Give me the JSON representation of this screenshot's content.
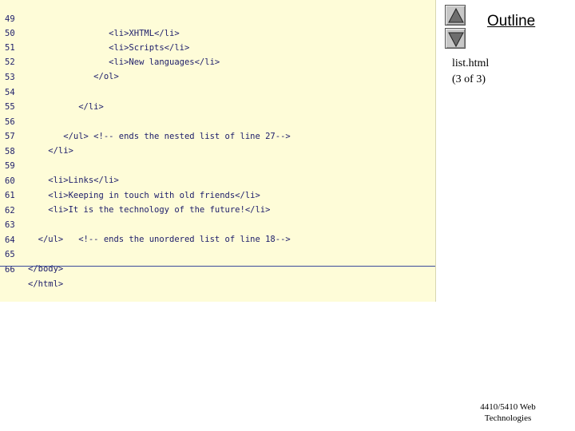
{
  "code_lines": [
    {
      "num": "49",
      "text": "                <li>XHTML</li>"
    },
    {
      "num": "50",
      "text": "                <li>Scripts</li>"
    },
    {
      "num": "51",
      "text": "                <li>New languages</li>"
    },
    {
      "num": "52",
      "text": "             </ol>"
    },
    {
      "num": "53",
      "text": ""
    },
    {
      "num": "54",
      "text": "          </li>"
    },
    {
      "num": "55",
      "text": ""
    },
    {
      "num": "56",
      "text": "       </ul> <!-- ends the nested list of line 27-->"
    },
    {
      "num": "57",
      "text": "    </li>"
    },
    {
      "num": "58",
      "text": ""
    },
    {
      "num": "59",
      "text": "    <li>Links</li>"
    },
    {
      "num": "60",
      "text": "    <li>Keeping in touch with old friends</li>"
    },
    {
      "num": "61",
      "text": "    <li>It is the technology of the future!</li>"
    },
    {
      "num": "62",
      "text": ""
    },
    {
      "num": "63",
      "text": "  </ul>   <!-- ends the unordered list of line 18-->"
    },
    {
      "num": "64",
      "text": ""
    },
    {
      "num": "65",
      "text": "</body>"
    },
    {
      "num": "66",
      "text": "</html>"
    }
  ],
  "sidebar": {
    "outline_label": "Outline",
    "file_name": "list.html",
    "page_indicator": "(3 of 3)",
    "prev_icon": "triangle-up-icon",
    "next_icon": "triangle-down-icon"
  },
  "footer": {
    "line1": "4410/5410 Web",
    "line2": "Technologies"
  },
  "colors": {
    "code_background": "#fefcd8",
    "code_text": "#1d1d6a"
  }
}
